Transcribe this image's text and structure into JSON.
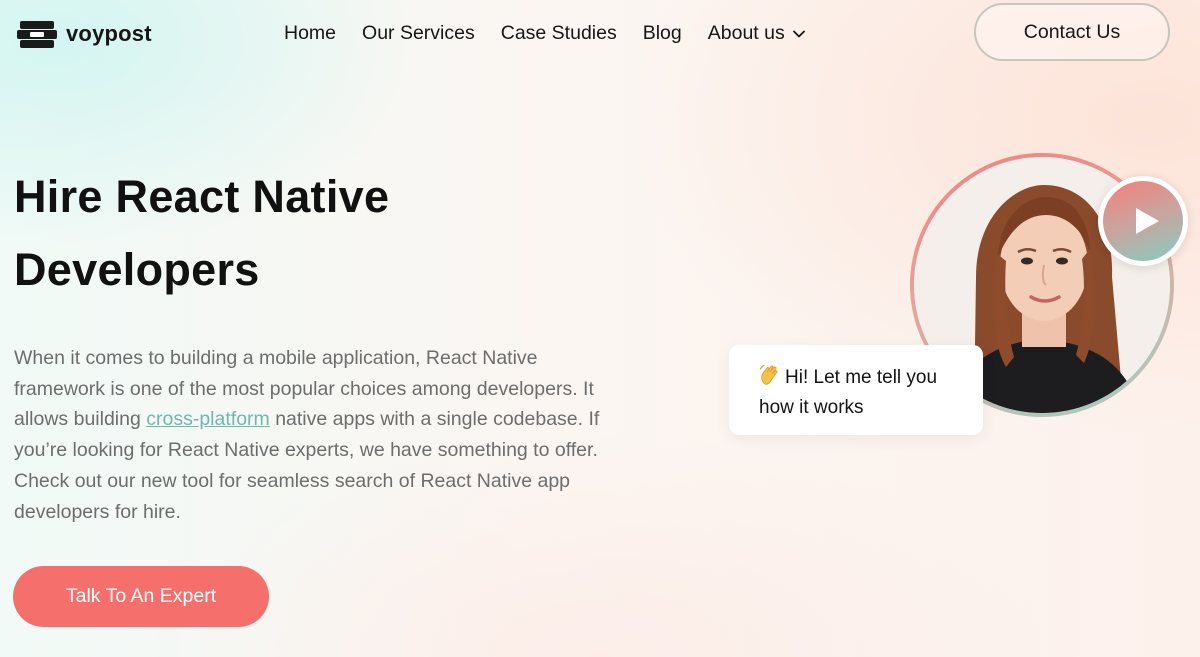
{
  "brand": {
    "name": "voypost",
    "logo_icon": "stacked-boxes-logo"
  },
  "nav": {
    "items": [
      {
        "label": "Home"
      },
      {
        "label": "Our Services"
      },
      {
        "label": "Case Studies"
      },
      {
        "label": "Blog"
      },
      {
        "label": "About us",
        "icon": "chevron-down-icon"
      }
    ],
    "contact_label": "Contact Us"
  },
  "hero": {
    "title_line1": "Hire React Native",
    "title_line2": "Developers",
    "desc_before_link": "When it comes to building a mobile application, React Native framework is one of the most popular choices among developers. It allows building ",
    "desc_link": "cross-platform",
    "desc_after_link": " native apps with a single codebase. If you’re looking for React Native experts, we have something to offer. Check out our new tool for seamless search of React Native app developers for hire.",
    "cta_label": "Talk To An Expert"
  },
  "video": {
    "play_icon": "play-icon",
    "bubble_emoji_icon": "waving-hand-icon",
    "bubble_text_line1": "Hi! Let me tell you",
    "bubble_text_line2": "how it works"
  },
  "colors": {
    "accent_coral": "#f56f6c",
    "link_teal": "#6fb8ae",
    "text_dark": "#141414",
    "text_muted": "#6d6d6d"
  }
}
